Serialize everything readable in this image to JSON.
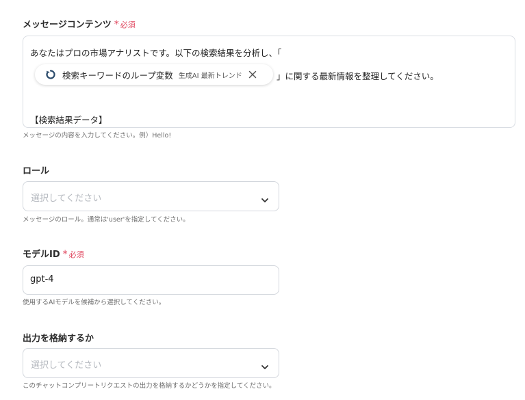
{
  "message_content": {
    "label": "メッセージコンテンツ",
    "required_label": "必須",
    "line1": "あなたはプロの市場アナリストです。以下の検索結果を分析し、「",
    "chip": {
      "label": "検索キーワードのループ変数",
      "tag": "生成AI 最新トレンド",
      "icon": "loop-icon"
    },
    "line2_after_chip": "」に関する最新情報を整理してください。",
    "line3": "【検索結果データ】",
    "help": "メッセージの内容を入力してください。例）Hello!"
  },
  "role": {
    "label": "ロール",
    "placeholder": "選択してください",
    "help": "メッセージのロール。通常は'user'を指定してください。"
  },
  "model_id": {
    "label": "モデルID",
    "required_label": "必須",
    "value": "gpt-4",
    "help": "使用するAIモデルを候補から選択してください。"
  },
  "store_output": {
    "label": "出力を格納するか",
    "placeholder": "選択してください",
    "help": "このチャットコンプリートリクエストの出力を格納するかどうかを指定してください。"
  },
  "colors": {
    "required": "#e0475f",
    "border": "#d3d7dd",
    "placeholder": "#b5b9bf",
    "icon_blue": "#2a4a6b"
  }
}
